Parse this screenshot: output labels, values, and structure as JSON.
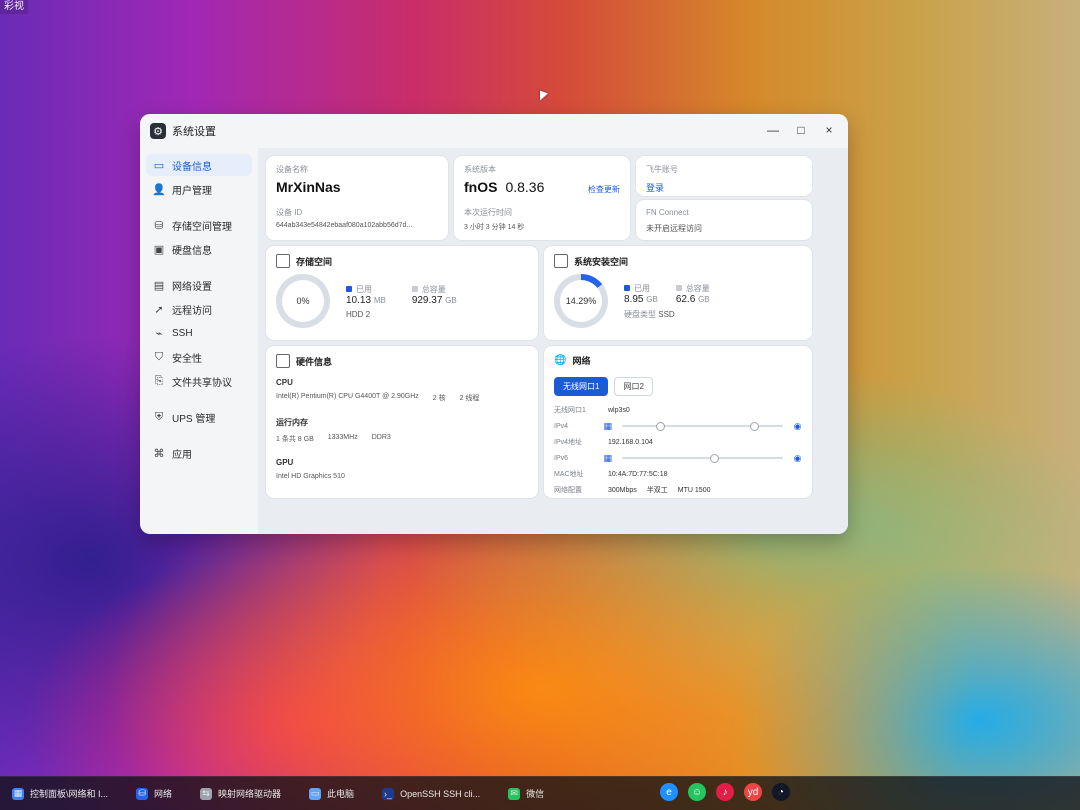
{
  "top_corner_text": "彩视",
  "window": {
    "title": "系统设置",
    "controls": {
      "minimize": "—",
      "maximize": "□",
      "close": "×"
    }
  },
  "sidebar": {
    "items": [
      {
        "label": "设备信息",
        "icon": "monitor-icon",
        "active": true
      },
      {
        "label": "用户管理",
        "icon": "user-icon",
        "active": false
      },
      {
        "label": "存储空间管理",
        "icon": "storage-icon",
        "active": false
      },
      {
        "label": "硬盘信息",
        "icon": "disk-icon",
        "active": false
      },
      {
        "label": "网络设置",
        "icon": "network-icon",
        "active": false
      },
      {
        "label": "远程访问",
        "icon": "remote-icon",
        "active": false
      },
      {
        "label": "SSH",
        "icon": "ssh-icon",
        "active": false
      },
      {
        "label": "安全性",
        "icon": "shield-icon",
        "active": false
      },
      {
        "label": "文件共享协议",
        "icon": "share-icon",
        "active": false
      },
      {
        "label": "UPS 管理",
        "icon": "ups-icon",
        "active": false
      },
      {
        "label": "应用",
        "icon": "apps-icon",
        "active": false
      }
    ]
  },
  "device": {
    "name_label": "设备名称",
    "name_value": "MrXinNas",
    "id_label": "设备 ID",
    "id_value": "644ab343e54842ebaaf080a102abb56d7d..."
  },
  "system": {
    "version_label": "系统版本",
    "os": "fnOS",
    "version": "0.8.36",
    "check_update": "检查更新",
    "uptime_label": "本次运行时间",
    "uptime_value": "3 小时 3 分钟 14 秒"
  },
  "account": {
    "account_label": "飞牛账号",
    "login_link": "登录",
    "connect_label": "FN Connect",
    "connect_status": "未开启远程访问"
  },
  "storage": {
    "title": "存储空间",
    "percent_text": "0%",
    "used_label": "已用",
    "used_value": "10.13",
    "used_unit": "MB",
    "total_label": "总容量",
    "total_value": "929.37",
    "total_unit": "GB",
    "disk_type": "HDD",
    "disk_count": "2",
    "percent": 0.0
  },
  "sys_storage": {
    "title": "系统安装空间",
    "percent_text": "14.29%",
    "used_label": "已用",
    "used_value": "8.95",
    "used_unit": "GB",
    "total_label": "总容量",
    "total_value": "62.6",
    "total_unit": "GB",
    "type_label": "硬盘类型",
    "type_value": "SSD",
    "percent": 14.29
  },
  "hardware": {
    "title": "硬件信息",
    "cpu_label": "CPU",
    "cpu_model": "Intel(R) Pentium(R) CPU G4400T @ 2.90GHz",
    "cpu_cores": "2 核",
    "cpu_threads": "2 线程",
    "mem_label": "运行内存",
    "mem_summary": "1 条共 8 GB",
    "mem_speed": "1333MHz",
    "mem_type": "DDR3",
    "gpu_label": "GPU",
    "gpu_model": "Intel HD Graphics 510"
  },
  "network": {
    "title": "网络",
    "tabs": [
      "无线网口1",
      "网口2"
    ],
    "rows": {
      "if_label": "无线网口1",
      "if_value": "wlp3s0",
      "ipv4_label": "IPv4",
      "ipv4_addr_label": "IPv4地址",
      "ipv4_addr_value": "192.168.0.104",
      "ipv6_label": "IPv6",
      "mac_label": "MAC地址",
      "mac_value": "10:4A:7D:77:5C:18",
      "cfg_label": "网络配置",
      "speed": "300Mbps",
      "duplex": "半双工",
      "mtu": "MTU 1500"
    }
  },
  "taskbar": {
    "items": [
      {
        "label": "控制面板\\网络和 I...",
        "icon": "control-panel-icon"
      },
      {
        "label": "网络",
        "icon": "network-icon"
      },
      {
        "label": "映射网络驱动器",
        "icon": "map-drive-icon"
      },
      {
        "label": "此电脑",
        "icon": "this-pc-icon"
      },
      {
        "label": "OpenSSH SSH cli...",
        "icon": "terminal-icon"
      },
      {
        "label": "微信",
        "icon": "wechat-icon"
      }
    ],
    "tray_icons": [
      {
        "name": "edge-icon",
        "color": "#1e90ff"
      },
      {
        "name": "wechat-tray-icon",
        "color": "#22c55e"
      },
      {
        "name": "netease-music-icon",
        "color": "#e11d48"
      },
      {
        "name": "youdao-icon",
        "color": "#ef4444"
      },
      {
        "name": "qq-icon",
        "color": "#111827"
      }
    ]
  }
}
